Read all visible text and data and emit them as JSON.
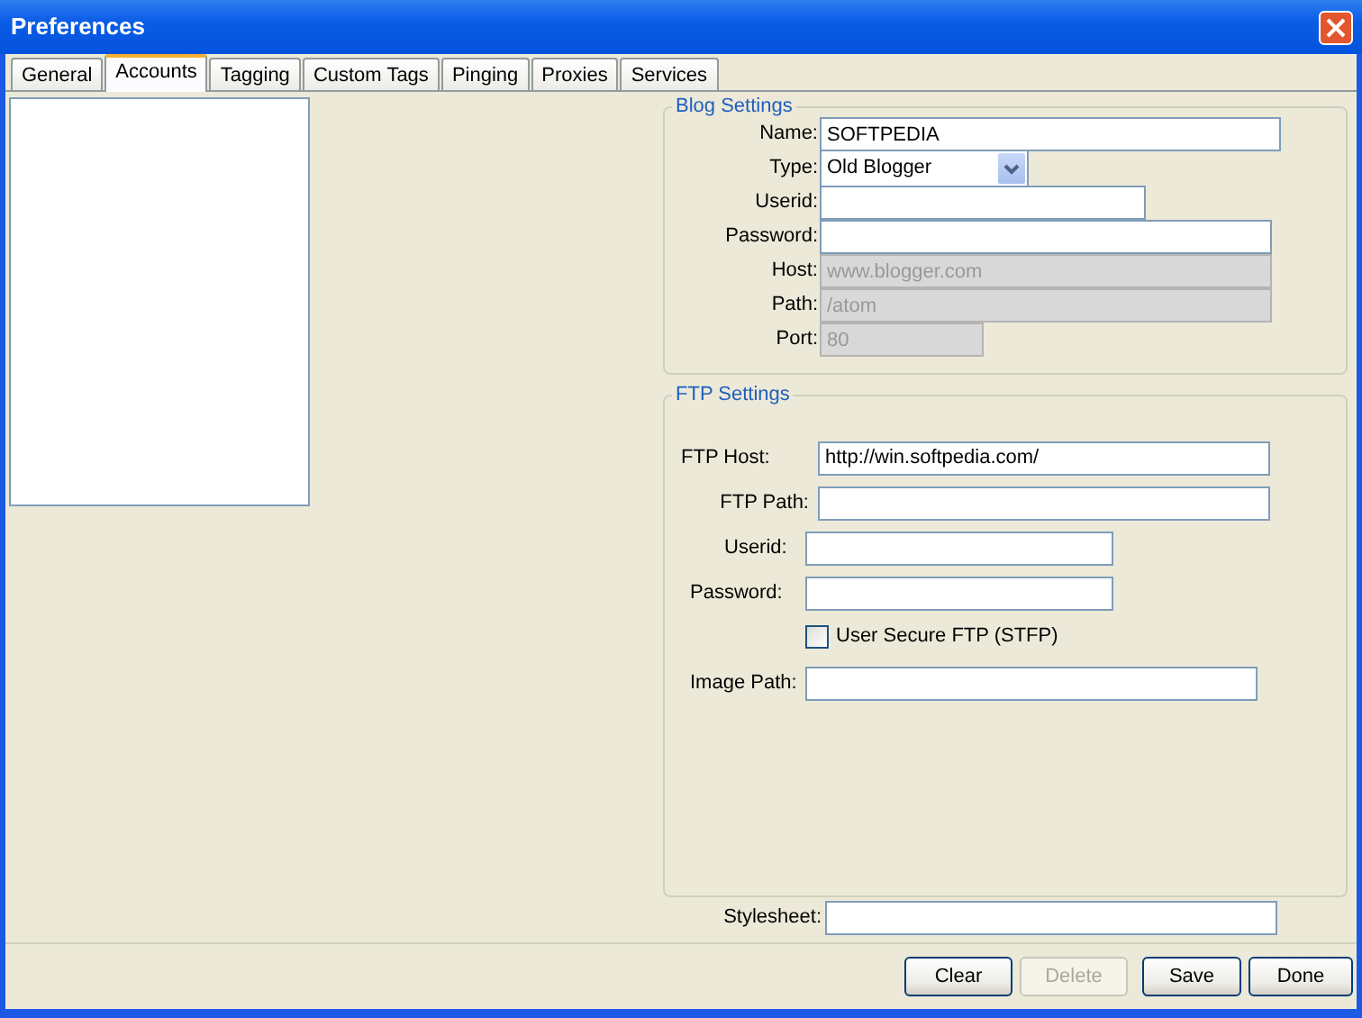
{
  "window": {
    "title": "Preferences"
  },
  "tabs": [
    {
      "label": "General",
      "selected": false
    },
    {
      "label": "Accounts",
      "selected": true
    },
    {
      "label": "Tagging",
      "selected": false
    },
    {
      "label": "Custom Tags",
      "selected": false
    },
    {
      "label": "Pinging",
      "selected": false
    },
    {
      "label": "Proxies",
      "selected": false
    },
    {
      "label": "Services",
      "selected": false
    }
  ],
  "blog_settings": {
    "title": "Blog Settings",
    "fields": [
      {
        "kind": "text",
        "label": "Name:",
        "value": "SOFTPEDIA",
        "disabled": false
      },
      {
        "kind": "select",
        "label": "Type:",
        "value": "Old Blogger"
      },
      {
        "kind": "text",
        "label": "Userid:",
        "disabled": false
      },
      {
        "kind": "text",
        "label": "Password:",
        "disabled": false
      },
      {
        "kind": "text",
        "label": "Host:",
        "value": "www.blogger.com",
        "disabled": true
      },
      {
        "kind": "text",
        "label": "Path:",
        "value": "/atom",
        "disabled": true
      },
      {
        "kind": "text",
        "label": "Port:",
        "value": "80",
        "disabled": true
      }
    ]
  },
  "ftp_settings": {
    "title": "FTP Settings",
    "fields": [
      {
        "kind": "text",
        "label": "FTP Host:",
        "value": "http://win.softpedia.com/"
      },
      {
        "kind": "text",
        "label": "FTP Path:"
      },
      {
        "kind": "text",
        "label": "Userid:"
      },
      {
        "kind": "text",
        "label": "Password:"
      },
      {
        "kind": "checkbox",
        "label": "User Secure FTP (STFP)",
        "checked": false
      },
      {
        "kind": "text",
        "label": "Image Path:"
      }
    ]
  },
  "stylesheet": {
    "label": "Stylesheet:"
  },
  "buttons": [
    {
      "label": "Clear",
      "disabled": false
    },
    {
      "label": "Delete",
      "disabled": true
    },
    {
      "label": "Save",
      "disabled": false
    },
    {
      "label": "Done",
      "disabled": false
    }
  ]
}
